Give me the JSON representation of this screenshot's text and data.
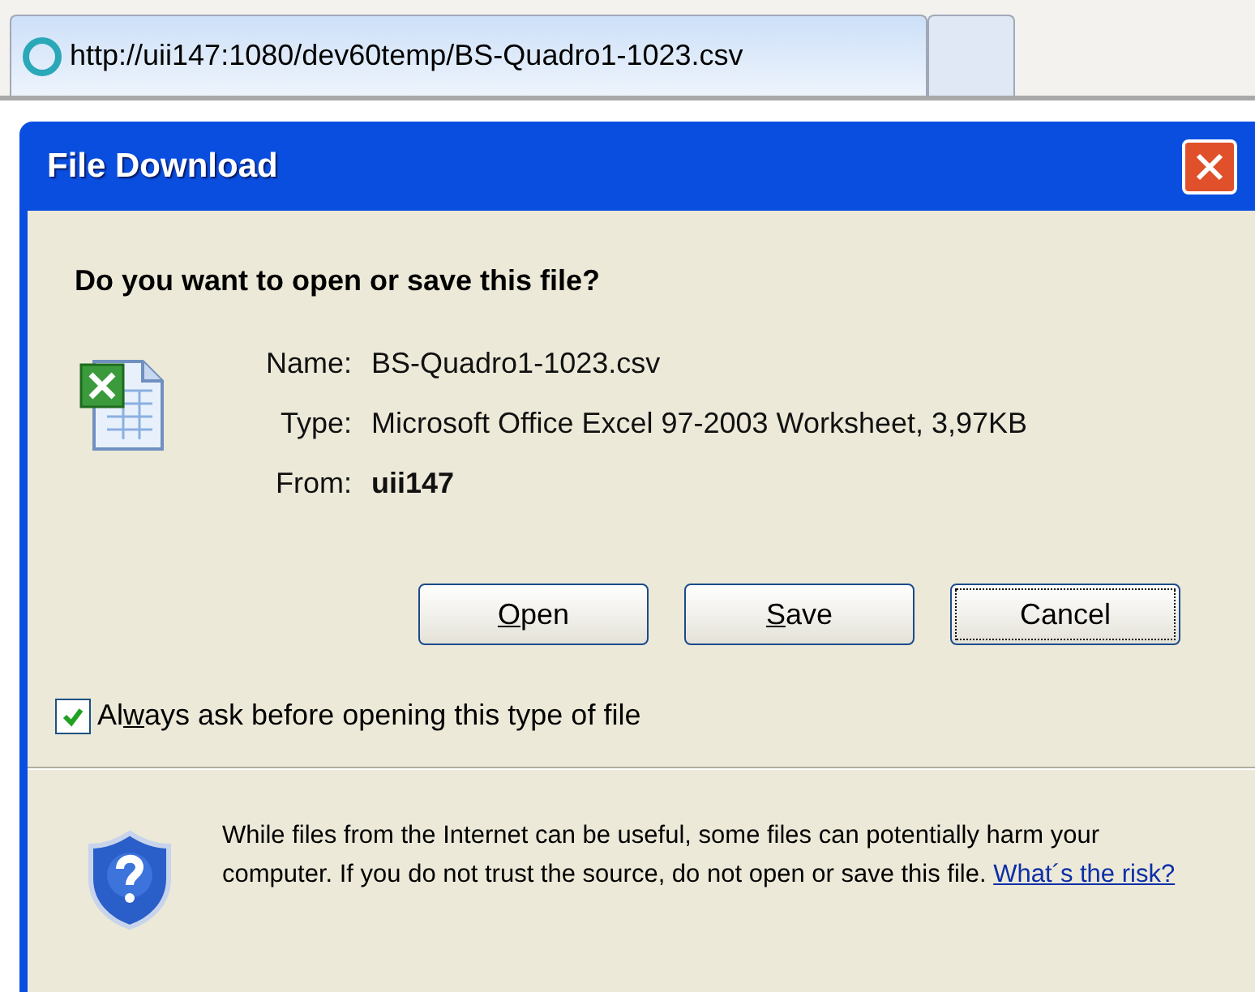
{
  "browser_tabs": [
    {
      "title": "http://uii147:1080/dev60temp/BS-Quadro1-1023.csv",
      "selected": true
    },
    {
      "selected": false
    }
  ],
  "dialog": {
    "title": "File Download",
    "question": "Do you want to open or save this file?",
    "fields": [
      {
        "label": "Name:",
        "value": "BS-Quadro1-1023.csv",
        "bold": false
      },
      {
        "label": "Type:",
        "value": "Microsoft Office Excel 97-2003 Worksheet, 3,97KB",
        "bold": false
      },
      {
        "label": "From:",
        "value": "uii147",
        "bold": true
      }
    ],
    "buttons": [
      {
        "label_parts": {
          "key": "O",
          "after": "pen"
        },
        "focused": false
      },
      {
        "label_parts": {
          "key": "S",
          "after": "ave"
        },
        "focused": false
      },
      {
        "label_parts": {
          "before": "Cancel"
        },
        "focused": true
      }
    ],
    "checkbox": {
      "label_parts": {
        "before": "Al",
        "key": "w",
        "after": "ays ask before opening this type of file"
      },
      "checked": true
    },
    "warning": {
      "text": "While files from the Internet can be useful, some files can potentially harm your computer. If you do not trust the source, do not open or save this file.",
      "link": "What´s the risk?"
    }
  }
}
